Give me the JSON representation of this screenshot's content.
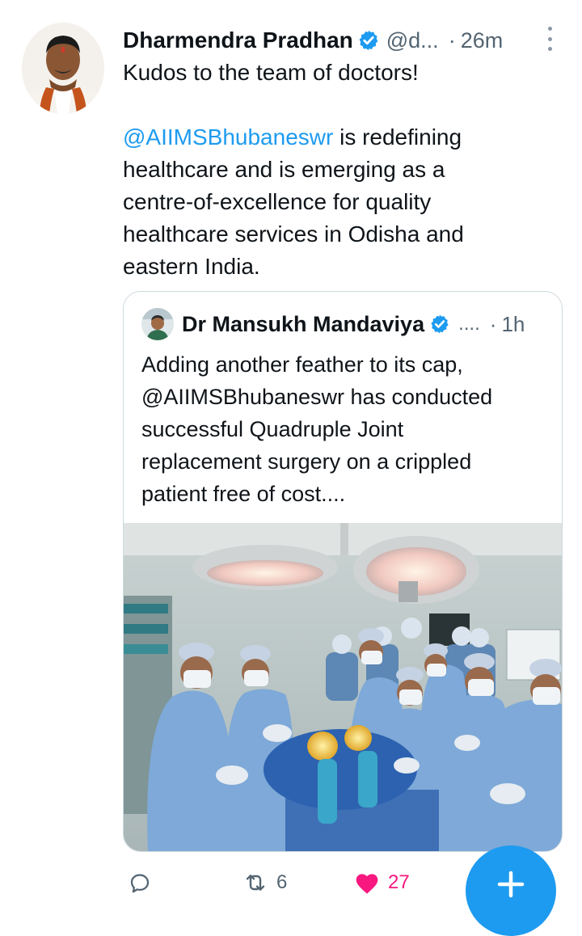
{
  "tweet": {
    "author": {
      "name": "Dharmendra Pradhan",
      "handle": "@d...",
      "verified": true
    },
    "separator": "·",
    "time": "26m",
    "text_line1": "Kudos to the team of doctors!",
    "mention": "@AIIMSBhubaneswr",
    "text_rest_line1": " is redefining",
    "text_line3": "healthcare and is emerging as a",
    "text_line4": "centre-of-excellence for quality",
    "text_line5": "healthcare services in Odisha and",
    "text_line6": "eastern India."
  },
  "quoted_tweet": {
    "author": {
      "name": "Dr Mansukh Mandaviya",
      "handle": "....",
      "verified": true
    },
    "separator": "·",
    "time": "1h",
    "text_lines": [
      "Adding another feather to its cap,",
      "@AIIMSBhubaneswr has conducted",
      "successful Quadruple Joint",
      "replacement surgery on a crippled",
      "patient free of cost...."
    ]
  },
  "actions": {
    "reply_count": "",
    "retweet_count": "6",
    "like_count": "27",
    "liked": true
  },
  "colors": {
    "accent": "#1d9bf0",
    "like": "#f91880",
    "secondary_text": "#536471",
    "border": "#cfd9de"
  },
  "icons": {
    "verified": "verified-badge-icon",
    "more": "more-vertical-icon",
    "reply": "reply-icon",
    "retweet": "retweet-icon",
    "like": "heart-icon",
    "compose": "plus-icon"
  }
}
